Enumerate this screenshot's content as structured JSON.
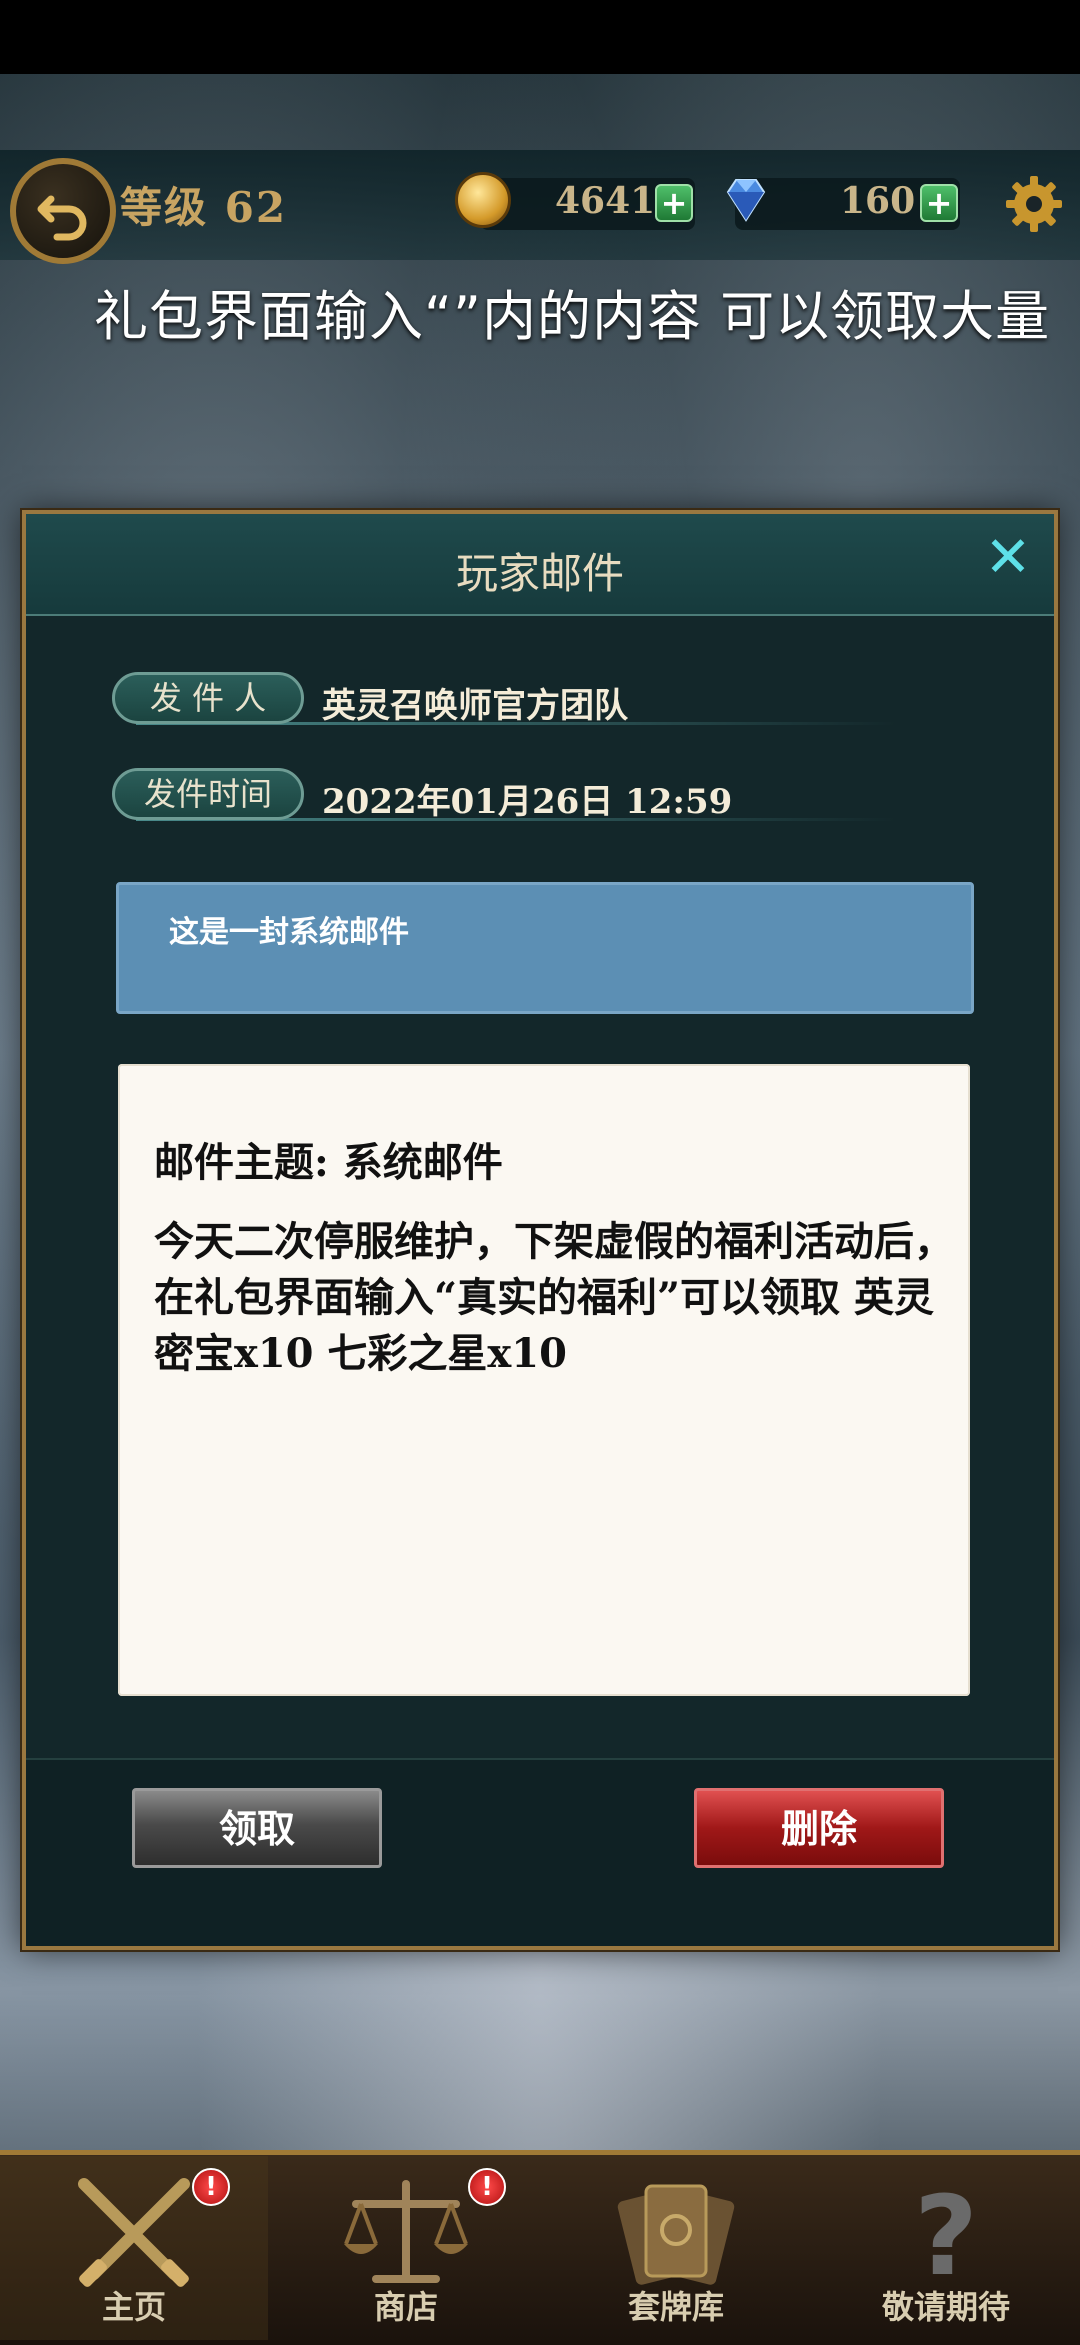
{
  "hud": {
    "level": "等级 62",
    "gold": "4641",
    "gems": "160",
    "plus": "+"
  },
  "banner": "礼包界面输入“”内的内容 可以领取大量",
  "dialog": {
    "title": "玩家邮件",
    "close": "✕",
    "sender_label": "发 件 人",
    "sender_value": "英灵召唤师官方团队",
    "time_label": "发件时间",
    "time_value": "2022年01月26日  12:59",
    "system_note": "这是一封系统邮件",
    "subject": "邮件主题: 系统邮件",
    "body": "今天二次停服维护，下架虚假的福利活动后，在礼包界面输入“真实的福利”可以领取 英灵密宝x10 七彩之星x10",
    "claim_label": "领取",
    "delete_label": "删除"
  },
  "nav": {
    "items": [
      {
        "label": "主页",
        "badge": "!"
      },
      {
        "label": "商店",
        "badge": "!"
      },
      {
        "label": "套牌库",
        "badge": ""
      },
      {
        "label": "敬请期待",
        "badge": ""
      }
    ]
  },
  "colors": {
    "frame_gold": "#9a7840",
    "dialog_bg": "#13272a",
    "system_box": "#5c8fb4",
    "delete_red": "#a01818",
    "close_cyan": "#5ee0e8"
  }
}
